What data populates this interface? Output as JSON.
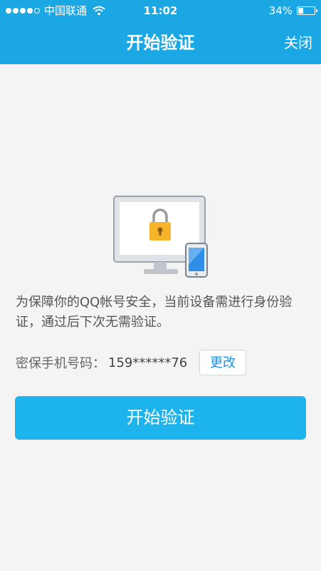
{
  "status_bar": {
    "carrier": "中国联通",
    "time": "11:02",
    "battery": "34%",
    "battery_level": 0.34
  },
  "nav": {
    "title": "开始验证",
    "close_label": "关闭"
  },
  "main": {
    "description": "为保障你的QQ帐号安全，当前设备需进行身份验证，通过后下次无需验证。",
    "phone_label": "密保手机号码：",
    "phone_number": "159******76",
    "change_label": "更改",
    "start_label": "开始验证"
  },
  "colors": {
    "header": "#1aa7e4",
    "button": "#1db4ee",
    "link": "#1a93e3",
    "background": "#f4f4f4"
  }
}
